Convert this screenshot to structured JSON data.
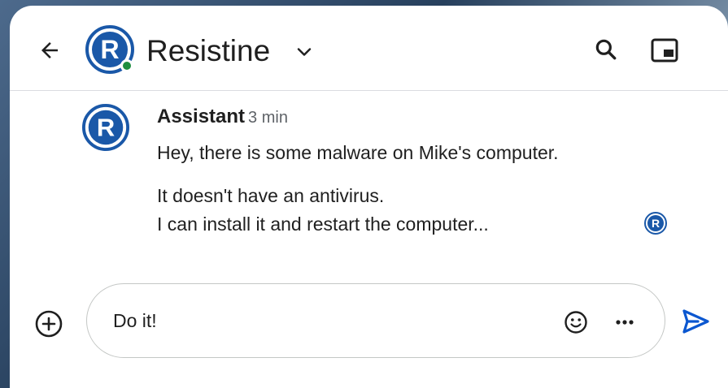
{
  "header": {
    "title": "Resistine",
    "presence": "online"
  },
  "message": {
    "sender": "Assistant",
    "time": "3 min",
    "lines": [
      "Hey, there is some malware on Mike's computer.",
      "It doesn't have an antivirus.",
      "I can install it and restart the computer..."
    ]
  },
  "composer": {
    "value": "Do it!"
  },
  "icons": {
    "back": "arrow-back-icon",
    "chevron": "chevron-down-icon",
    "search": "search-icon",
    "pip": "picture-in-picture-icon",
    "plus": "add-circle-icon",
    "emoji": "emoji-icon",
    "more": "more-horizontal-icon",
    "send": "send-icon",
    "avatar_logo": "resistine-logo"
  },
  "colors": {
    "brand_blue": "#1a58a8",
    "presence_green": "#1e8e3e",
    "send_blue": "#0b57d0",
    "text": "#1f1f1f",
    "muted": "#5f6368"
  }
}
